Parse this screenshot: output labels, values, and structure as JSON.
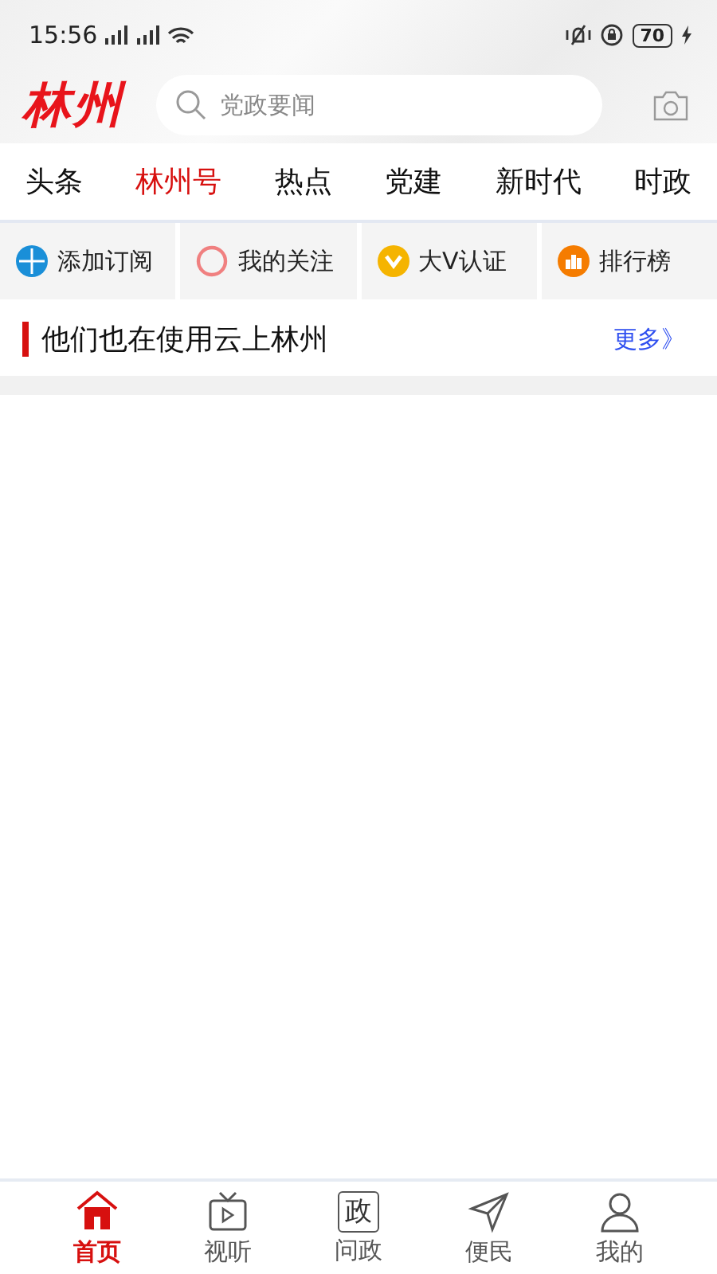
{
  "status_bar": {
    "time": "15:56",
    "battery": "70"
  },
  "header": {
    "logo": "林州",
    "search": {
      "placeholder": "党政要闻"
    }
  },
  "tabs": [
    {
      "label": "头条",
      "selected": false
    },
    {
      "label": "林州号",
      "selected": true
    },
    {
      "label": "热点",
      "selected": false
    },
    {
      "label": "党建",
      "selected": false
    },
    {
      "label": "新时代",
      "selected": false
    },
    {
      "label": "时政",
      "selected": false
    }
  ],
  "shortcuts": [
    {
      "label": "添加订阅",
      "kind": "add",
      "color": "#1a8fd8"
    },
    {
      "label": "我的关注",
      "kind": "ring",
      "color": "#f08080"
    },
    {
      "label": "大V认证",
      "kind": "check",
      "color": "#f5b400"
    },
    {
      "label": "排行榜",
      "kind": "rank",
      "color": "#f57c00"
    }
  ],
  "section": {
    "title": "他们也在使用云上林州",
    "more": "更多》"
  },
  "bottom_nav": [
    {
      "label": "首页",
      "kind": "home",
      "selected": true
    },
    {
      "label": "视听",
      "kind": "tv",
      "selected": false
    },
    {
      "label": "问政",
      "kind": "gov",
      "icon_text": "政",
      "selected": false
    },
    {
      "label": "便民",
      "kind": "send",
      "selected": false
    },
    {
      "label": "我的",
      "kind": "user",
      "selected": false
    }
  ]
}
